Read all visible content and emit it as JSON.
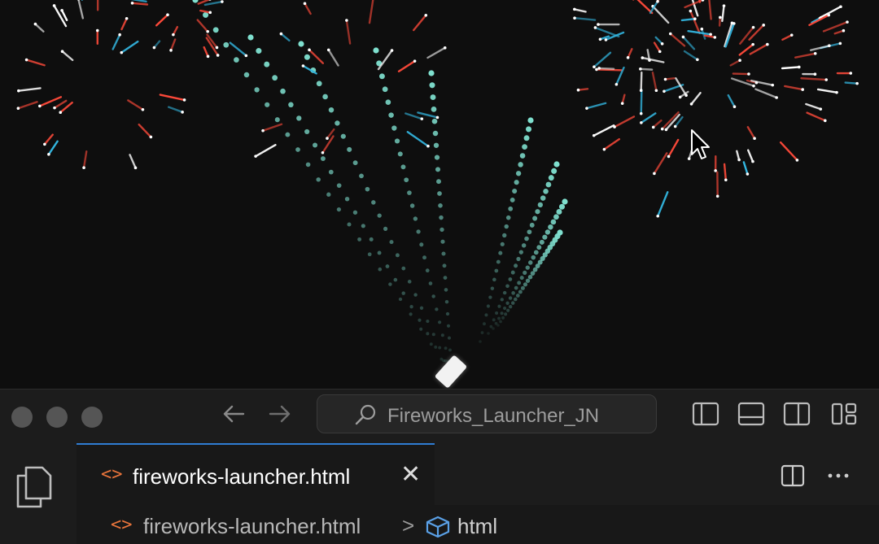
{
  "window": {
    "search_text": "Fireworks_Launcher_JN"
  },
  "tab": {
    "label": "fireworks-launcher.html"
  },
  "breadcrumb": {
    "file": "fireworks-launcher.html",
    "separator": ">",
    "element": "html"
  },
  "icons": {
    "traffic_lights": [
      "close-dot",
      "minimize-dot",
      "zoom-dot"
    ],
    "nav": [
      "back-arrow-icon",
      "forward-arrow-icon"
    ],
    "layout": [
      "toggle-primary-sidebar-icon",
      "toggle-panel-icon",
      "toggle-secondary-sidebar-icon",
      "customize-layout-icon"
    ],
    "editor": [
      "split-editor-icon",
      "more-actions-icon"
    ],
    "file": "html-file-icon",
    "element": "html-element-icon"
  },
  "colors": {
    "accent_tab": "#2f7dd3",
    "html_icon": "#e8743b",
    "rocket_trail": "#7fe0cf",
    "spark_red": "#ff4a3a",
    "spark_blue": "#33b6e0"
  }
}
